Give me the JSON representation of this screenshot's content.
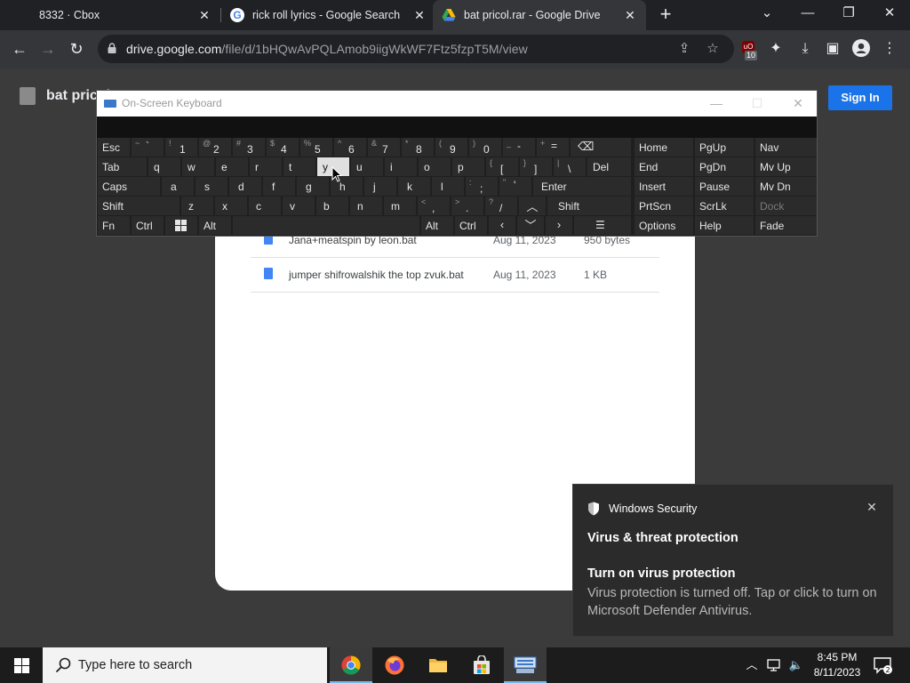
{
  "browser": {
    "tabs": [
      {
        "title": "8332 · Cbox",
        "active": false
      },
      {
        "title": "rick roll lyrics - Google Search",
        "active": false
      },
      {
        "title": "bat pricol.rar - Google Drive",
        "active": true
      }
    ],
    "close_glyph": "✕",
    "new_tab_glyph": "+",
    "url_host": "drive.google.com",
    "url_path": "/file/d/1bHQwAvPQLAmob9iigWkWF7Ftz5fzpT5M/view",
    "extension_badge": "10"
  },
  "drive": {
    "title": "bat pricol",
    "signin_label": "Sign In",
    "files": [
      {
        "name": "Jana+meatspin by leon.bat",
        "date": "Aug 11, 2023",
        "size": "950 bytes"
      },
      {
        "name": "jumper shifrowalshik the top zvuk.bat",
        "date": "Aug 11, 2023",
        "size": "1 KB"
      }
    ]
  },
  "osk": {
    "title": "On-Screen Keyboard",
    "keys": {
      "esc": "Esc",
      "tab": "Tab",
      "caps": "Caps",
      "shift": "Shift",
      "fn": "Fn",
      "ctrl": "Ctrl",
      "alt": "Alt",
      "del": "Del",
      "enter": "Enter",
      "home": "Home",
      "pgup": "PgUp",
      "nav": "Nav",
      "end": "End",
      "pgdn": "PgDn",
      "mvup": "Mv Up",
      "insert": "Insert",
      "pause": "Pause",
      "mvdn": "Mv Dn",
      "prtscn": "PrtScn",
      "scrlk": "ScrLk",
      "dock": "Dock",
      "options": "Options",
      "help": "Help",
      "fade": "Fade",
      "tilde_sup": "~",
      "tilde_low": "`",
      "n1_sup": "!",
      "n1": "1",
      "n2_sup": "@",
      "n2": "2",
      "n3_sup": "#",
      "n3": "3",
      "n4_sup": "$",
      "n4": "4",
      "n5_sup": "%",
      "n5": "5",
      "n6_sup": "^",
      "n6": "6",
      "n7_sup": "&",
      "n7": "7",
      "n8_sup": "*",
      "n8": "8",
      "n9_sup": "(",
      "n9": "9",
      "n0_sup": ")",
      "n0": "0",
      "minus_sup": "_",
      "minus": "-",
      "eq_sup": "+",
      "eq": "=",
      "q": "q",
      "w": "w",
      "e": "e",
      "r": "r",
      "t": "t",
      "y": "y",
      "u": "u",
      "i": "i",
      "o": "o",
      "p": "p",
      "lbr_sup": "{",
      "lbr": "[",
      "rbr_sup": "}",
      "rbr": "]",
      "bsl_sup": "|",
      "bsl": "\\",
      "a": "a",
      "s": "s",
      "d": "d",
      "f": "f",
      "g": "g",
      "h": "h",
      "j": "j",
      "k": "k",
      "l": "l",
      "semi_sup": ":",
      "semi": ";",
      "quote_sup": "\"",
      "quote": "'",
      "z": "z",
      "x": "x",
      "c": "c",
      "v": "v",
      "b": "b",
      "n": "n",
      "m": "m",
      "comma_sup": "<",
      "comma": ",",
      "period_sup": ">",
      "period": ".",
      "slash_sup": "?",
      "slash": "/"
    }
  },
  "toast": {
    "app": "Windows Security",
    "heading": "Virus & threat protection",
    "subheading": "Turn on virus protection",
    "body": "Virus protection is turned off. Tap or click to turn on Microsoft Defender Antivirus.",
    "close_glyph": "✕"
  },
  "taskbar": {
    "search_placeholder": "Type here to search",
    "time": "8:45 PM",
    "date": "8/11/2023"
  },
  "colors": {
    "accent_blue": "#1a73e8",
    "taskbar_accent": "#76b9ed"
  }
}
